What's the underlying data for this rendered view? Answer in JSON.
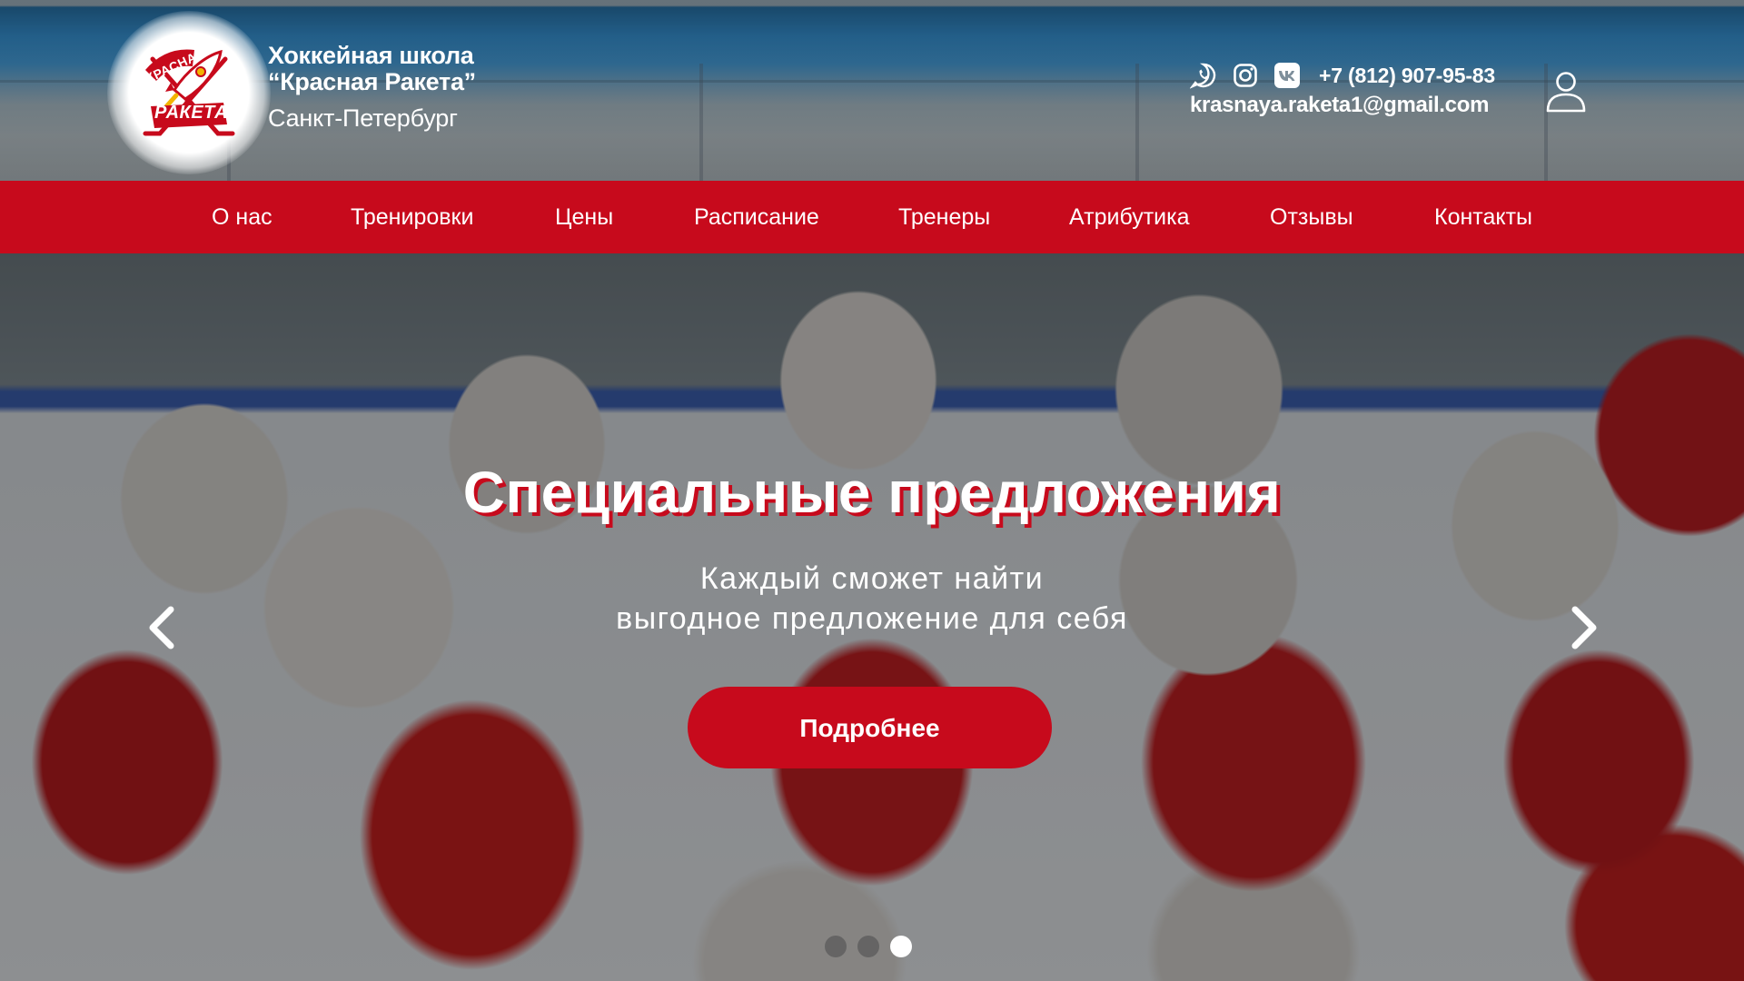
{
  "brand": {
    "line1": "Хоккейная школа",
    "line2": "“Красная Ракета”",
    "city": "Санкт-Петербург",
    "logo_text_top": "КРАСНАЯ",
    "logo_text_bottom": "РАКЕТА"
  },
  "contacts": {
    "social": [
      "whatsapp-icon",
      "instagram-icon",
      "vk-icon"
    ],
    "phone": "+7 (812) 907-95-83",
    "email": "krasnaya.raketa1@gmail.com"
  },
  "nav": {
    "items": [
      {
        "label": "О нас"
      },
      {
        "label": "Тренировки"
      },
      {
        "label": "Цены"
      },
      {
        "label": "Расписание"
      },
      {
        "label": "Тренеры"
      },
      {
        "label": "Атрибутика"
      },
      {
        "label": "Отзывы"
      },
      {
        "label": "Контакты"
      }
    ]
  },
  "hero": {
    "title": "Специальные предложения",
    "subtitle_line1": "Каждый сможет найти",
    "subtitle_line2": "выгодное предложение для себя",
    "button_label": "Подробнее",
    "slides_count": 3,
    "active_slide": 3
  },
  "colors": {
    "accent": "#c70a1c",
    "text": "#ffffff"
  }
}
